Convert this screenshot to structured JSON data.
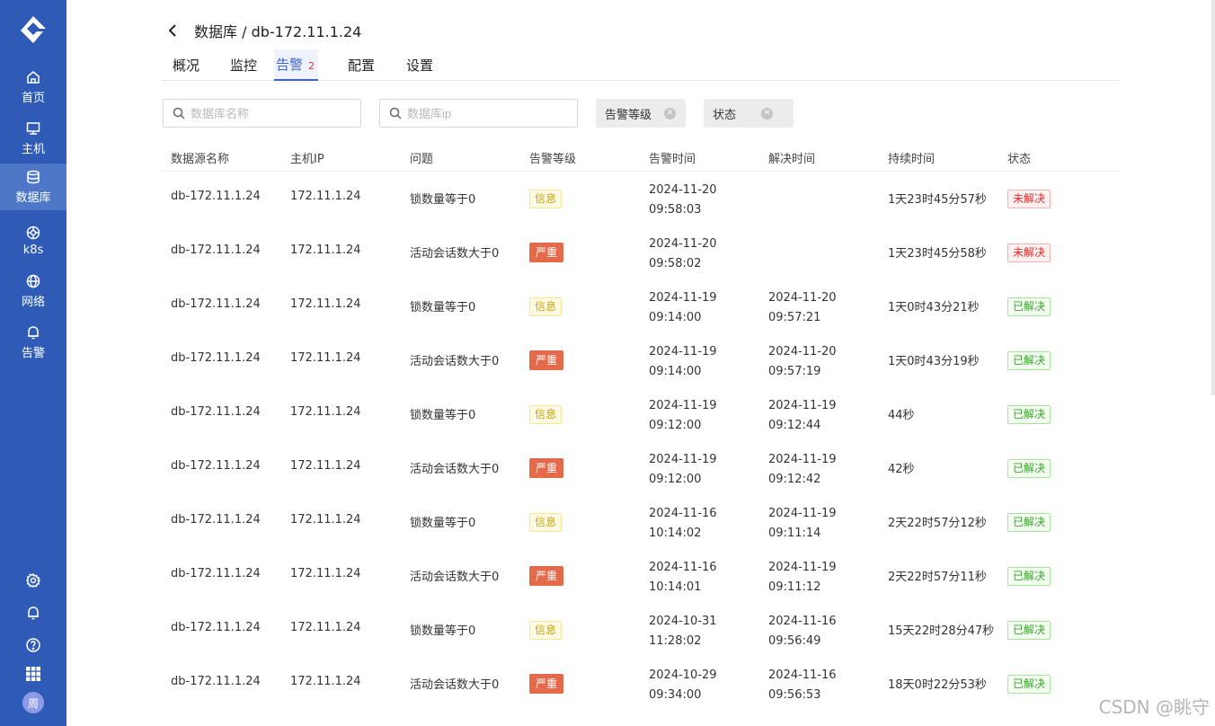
{
  "sidebar": {
    "items": [
      {
        "label": "首页",
        "icon": "home-icon"
      },
      {
        "label": "主机",
        "icon": "monitor-icon"
      },
      {
        "label": "数据库",
        "icon": "database-icon"
      },
      {
        "label": "k8s",
        "icon": "k8s-icon"
      },
      {
        "label": "网络",
        "icon": "globe-icon"
      },
      {
        "label": "告警",
        "icon": "bell-icon"
      }
    ],
    "avatar": "周"
  },
  "breadcrumb": "数据库 / db-172.11.1.24",
  "tabs": [
    {
      "label": "概况"
    },
    {
      "label": "监控"
    },
    {
      "label": "告警",
      "badge": "2"
    },
    {
      "label": "配置"
    },
    {
      "label": "设置"
    }
  ],
  "filters": {
    "name_placeholder": "数据库名称",
    "ip_placeholder": "数据库ip",
    "level": "告警等级",
    "status": "状态"
  },
  "table": {
    "headers": [
      "数据源名称",
      "主机IP",
      "问题",
      "告警等级",
      "告警时间",
      "解决时间",
      "持续时间",
      "状态"
    ],
    "rows": [
      {
        "name": "db-172.11.1.24",
        "ip": "172.11.1.24",
        "issue": "锁数量等于0",
        "level": "信息",
        "level_type": "info",
        "alert_date": "2024-11-20",
        "alert_time": "09:58:03",
        "resolve_date": "",
        "resolve_time": "",
        "duration": "1天23时45分57秒",
        "status": "未解决",
        "status_type": "open"
      },
      {
        "name": "db-172.11.1.24",
        "ip": "172.11.1.24",
        "issue": "活动会话数大于0",
        "level": "严重",
        "level_type": "severe",
        "alert_date": "2024-11-20",
        "alert_time": "09:58:02",
        "resolve_date": "",
        "resolve_time": "",
        "duration": "1天23时45分58秒",
        "status": "未解决",
        "status_type": "open"
      },
      {
        "name": "db-172.11.1.24",
        "ip": "172.11.1.24",
        "issue": "锁数量等于0",
        "level": "信息",
        "level_type": "info",
        "alert_date": "2024-11-19",
        "alert_time": "09:14:00",
        "resolve_date": "2024-11-20",
        "resolve_time": "09:57:21",
        "duration": "1天0时43分21秒",
        "status": "已解决",
        "status_type": "done"
      },
      {
        "name": "db-172.11.1.24",
        "ip": "172.11.1.24",
        "issue": "活动会话数大于0",
        "level": "严重",
        "level_type": "severe",
        "alert_date": "2024-11-19",
        "alert_time": "09:14:00",
        "resolve_date": "2024-11-20",
        "resolve_time": "09:57:19",
        "duration": "1天0时43分19秒",
        "status": "已解决",
        "status_type": "done"
      },
      {
        "name": "db-172.11.1.24",
        "ip": "172.11.1.24",
        "issue": "锁数量等于0",
        "level": "信息",
        "level_type": "info",
        "alert_date": "2024-11-19",
        "alert_time": "09:12:00",
        "resolve_date": "2024-11-19",
        "resolve_time": "09:12:44",
        "duration": "44秒",
        "status": "已解决",
        "status_type": "done"
      },
      {
        "name": "db-172.11.1.24",
        "ip": "172.11.1.24",
        "issue": "活动会话数大于0",
        "level": "严重",
        "level_type": "severe",
        "alert_date": "2024-11-19",
        "alert_time": "09:12:00",
        "resolve_date": "2024-11-19",
        "resolve_time": "09:12:42",
        "duration": "42秒",
        "status": "已解决",
        "status_type": "done"
      },
      {
        "name": "db-172.11.1.24",
        "ip": "172.11.1.24",
        "issue": "锁数量等于0",
        "level": "信息",
        "level_type": "info",
        "alert_date": "2024-11-16",
        "alert_time": "10:14:02",
        "resolve_date": "2024-11-19",
        "resolve_time": "09:11:14",
        "duration": "2天22时57分12秒",
        "status": "已解决",
        "status_type": "done"
      },
      {
        "name": "db-172.11.1.24",
        "ip": "172.11.1.24",
        "issue": "活动会话数大于0",
        "level": "严重",
        "level_type": "severe",
        "alert_date": "2024-11-16",
        "alert_time": "10:14:01",
        "resolve_date": "2024-11-19",
        "resolve_time": "09:11:12",
        "duration": "2天22时57分11秒",
        "status": "已解决",
        "status_type": "done"
      },
      {
        "name": "db-172.11.1.24",
        "ip": "172.11.1.24",
        "issue": "锁数量等于0",
        "level": "信息",
        "level_type": "info",
        "alert_date": "2024-10-31",
        "alert_time": "11:28:02",
        "resolve_date": "2024-11-16",
        "resolve_time": "09:56:49",
        "duration": "15天22时28分47秒",
        "status": "已解决",
        "status_type": "done"
      },
      {
        "name": "db-172.11.1.24",
        "ip": "172.11.1.24",
        "issue": "活动会话数大于0",
        "level": "严重",
        "level_type": "severe",
        "alert_date": "2024-10-29",
        "alert_time": "09:34:00",
        "resolve_date": "2024-11-16",
        "resolve_time": "09:56:53",
        "duration": "18天0时22分53秒",
        "status": "已解决",
        "status_type": "done"
      }
    ]
  },
  "watermark": "CSDN @眺守",
  "colors": {
    "sidebar": "#2f5bb7",
    "accent": "#3b63c7",
    "severe": "#e56a4b"
  }
}
